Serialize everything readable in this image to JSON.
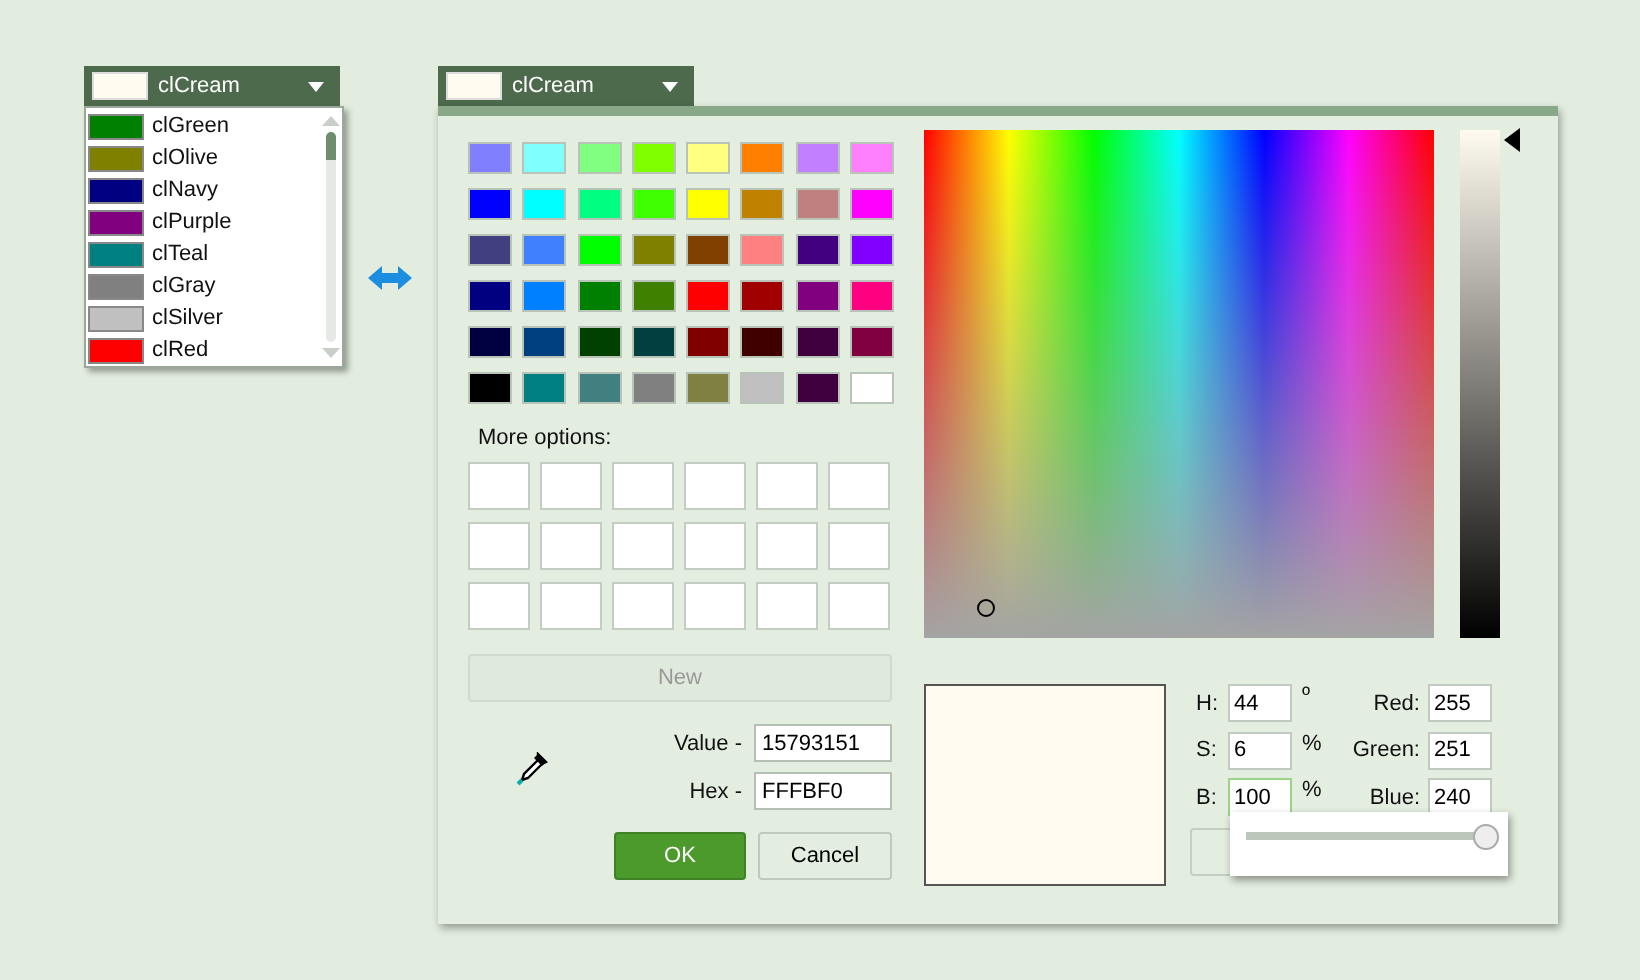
{
  "left_combo": {
    "value": "clCream",
    "swatch": {
      "color": "#fffbf0"
    },
    "list": [
      {
        "label": "clGreen",
        "color": "#008000"
      },
      {
        "label": "clOlive",
        "color": "#808000"
      },
      {
        "label": "clNavy",
        "color": "#000080"
      },
      {
        "label": "clPurple",
        "color": "#800080"
      },
      {
        "label": "clTeal",
        "color": "#008080"
      },
      {
        "label": "clGray",
        "color": "#808080"
      },
      {
        "label": "clSilver",
        "color": "#c0c0c0"
      },
      {
        "label": "clRed",
        "color": "#ff0000"
      }
    ]
  },
  "dialog": {
    "combo": {
      "value": "clCream",
      "swatch": {
        "color": "#fffbf0"
      }
    },
    "palette": [
      {
        "color": "#8080ff"
      },
      {
        "color": "#80ffff"
      },
      {
        "color": "#80ff80"
      },
      {
        "color": "#80ff00"
      },
      {
        "color": "#ffff80"
      },
      {
        "color": "#ff8000"
      },
      {
        "color": "#c080ff"
      },
      {
        "color": "#ff80ff"
      },
      {
        "color": "#0000ff"
      },
      {
        "color": "#00ffff"
      },
      {
        "color": "#00ff80"
      },
      {
        "color": "#40ff00"
      },
      {
        "color": "#ffff00"
      },
      {
        "color": "#c08000"
      },
      {
        "color": "#c08080"
      },
      {
        "color": "#ff00ff"
      },
      {
        "color": "#404080"
      },
      {
        "color": "#4080ff"
      },
      {
        "color": "#00ff00"
      },
      {
        "color": "#808000"
      },
      {
        "color": "#804000"
      },
      {
        "color": "#ff8080"
      },
      {
        "color": "#400080"
      },
      {
        "color": "#8000ff"
      },
      {
        "color": "#000080"
      },
      {
        "color": "#0080ff"
      },
      {
        "color": "#008000"
      },
      {
        "color": "#408000"
      },
      {
        "color": "#ff0000"
      },
      {
        "color": "#a00000"
      },
      {
        "color": "#800080"
      },
      {
        "color": "#ff0080"
      },
      {
        "color": "#000040"
      },
      {
        "color": "#004080"
      },
      {
        "color": "#004000"
      },
      {
        "color": "#004040"
      },
      {
        "color": "#800000"
      },
      {
        "color": "#400000"
      },
      {
        "color": "#400040"
      },
      {
        "color": "#800040"
      },
      {
        "color": "#000000"
      },
      {
        "color": "#008080"
      },
      {
        "color": "#408080"
      },
      {
        "color": "#808080"
      },
      {
        "color": "#808040"
      },
      {
        "color": "#c0c0c0"
      },
      {
        "color": "#400040"
      },
      {
        "color": "#ffffff"
      }
    ],
    "more_options_label": "More options:",
    "custom_colors": [
      {
        "color": "#ffffff"
      },
      {
        "color": "#ffffff"
      },
      {
        "color": "#ffffff"
      },
      {
        "color": "#ffffff"
      },
      {
        "color": "#ffffff"
      },
      {
        "color": "#ffffff"
      },
      {
        "color": "#ffffff"
      },
      {
        "color": "#ffffff"
      },
      {
        "color": "#ffffff"
      },
      {
        "color": "#ffffff"
      },
      {
        "color": "#ffffff"
      },
      {
        "color": "#ffffff"
      },
      {
        "color": "#ffffff"
      },
      {
        "color": "#ffffff"
      },
      {
        "color": "#ffffff"
      },
      {
        "color": "#ffffff"
      },
      {
        "color": "#ffffff"
      },
      {
        "color": "#ffffff"
      }
    ],
    "new_button": {
      "label": "New",
      "disabled": true
    },
    "value_field": {
      "label": "Value -",
      "value": "15793151"
    },
    "hex_field": {
      "label": "Hex -",
      "value": "FFFBF0"
    },
    "ok_button": "OK",
    "cancel_button": "Cancel",
    "preview": {
      "color": "#fffbf0"
    },
    "brightness": {
      "level": 1
    },
    "hsb": [
      {
        "label": "H:",
        "value": "44",
        "unit": "º",
        "focused": false
      },
      {
        "label": "S:",
        "value": "6",
        "unit": "%",
        "focused": false
      },
      {
        "label": "B:",
        "value": "100",
        "unit": "%",
        "focused": true
      }
    ],
    "rgb": [
      {
        "label": "Red:",
        "value": "255"
      },
      {
        "label": "Green:",
        "value": "251"
      },
      {
        "label": "Blue:",
        "value": "240"
      }
    ],
    "popup_slider": {
      "level": 0.96
    }
  }
}
